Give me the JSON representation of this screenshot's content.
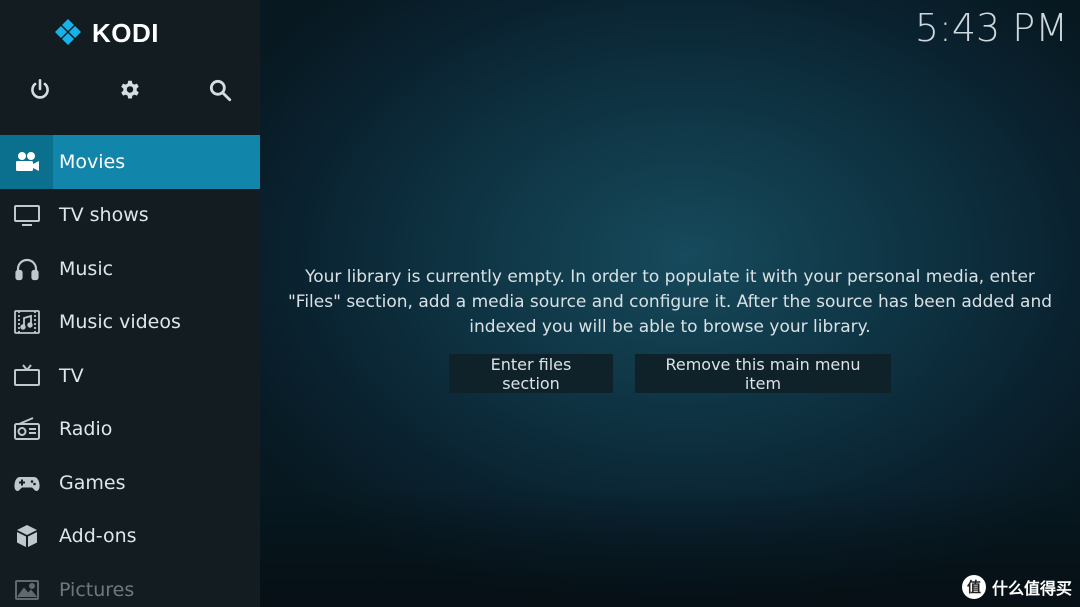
{
  "app": {
    "name": "KODI"
  },
  "clock": {
    "time": "5:43 PM"
  },
  "top_icons": [
    {
      "name": "power",
      "icon": "power-icon"
    },
    {
      "name": "settings",
      "icon": "gear-icon"
    },
    {
      "name": "search",
      "icon": "search-icon"
    }
  ],
  "menu": {
    "items": [
      {
        "label": "Movies",
        "icon": "movie-camera-icon"
      },
      {
        "label": "TV shows",
        "icon": "monitor-icon"
      },
      {
        "label": "Music",
        "icon": "headphones-icon"
      },
      {
        "label": "Music videos",
        "icon": "music-video-icon"
      },
      {
        "label": "TV",
        "icon": "tv-icon"
      },
      {
        "label": "Radio",
        "icon": "radio-icon"
      },
      {
        "label": "Games",
        "icon": "gamepad-icon"
      },
      {
        "label": "Add-ons",
        "icon": "addons-box-icon"
      },
      {
        "label": "Pictures",
        "icon": "picture-icon"
      }
    ],
    "active_index": 0
  },
  "main": {
    "message": "Your library is currently empty. In order to populate it with your personal media, enter \"Files\" section, add a media source and configure it. After the source has been added and indexed you will be able to browse your library.",
    "buttons": {
      "enter_files": "Enter files section",
      "remove_item": "Remove this main menu item"
    }
  },
  "watermark": {
    "badge": "值",
    "text": "什么值得买"
  },
  "colors": {
    "sidebar_bg": "#121c21",
    "active_bg": "#1186aa",
    "main_bg": "#0e3342",
    "button_bg": "#0f2129",
    "logo_blue": "#17b2e7"
  }
}
